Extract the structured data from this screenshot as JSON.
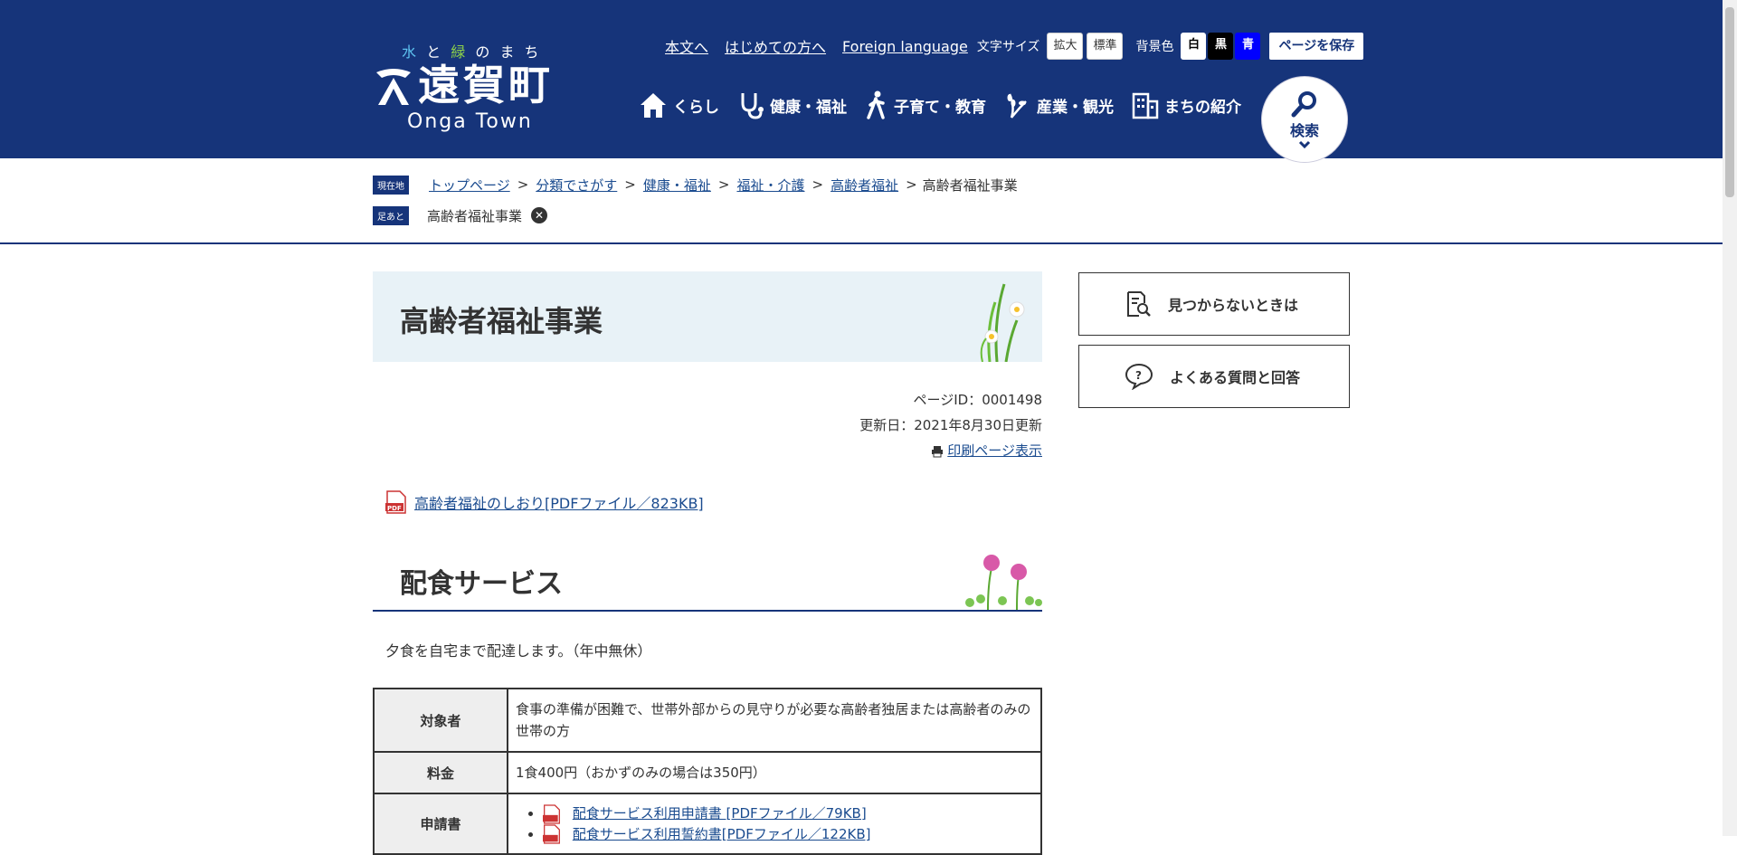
{
  "logo": {
    "tagline": [
      "水",
      "と",
      "緑",
      "の",
      "ま",
      "ち"
    ],
    "name": "遠賀町",
    "en": "Onga Town"
  },
  "util": {
    "links": [
      "本文へ",
      "はじめての方へ",
      "Foreign language"
    ],
    "font_size_label": "文字サイズ",
    "font_large": "拡大",
    "font_normal": "標準",
    "bg_label": "背景色",
    "bg_white": "白",
    "bg_black": "黒",
    "bg_blue": "青",
    "save_page": "ページを保存"
  },
  "gnav": [
    "くらし",
    "健康・福祉",
    "子育て・教育",
    "産業・観光",
    "まちの紹介"
  ],
  "search": {
    "label": "検索"
  },
  "breadcrumb": {
    "current_tag": "現在地",
    "trail_tag": "足あと",
    "links": [
      "トップページ",
      "分類でさがす",
      "健康・福祉",
      "福祉・介護",
      "高齢者福祉"
    ],
    "current": "高齢者福祉事業",
    "trail_item": "高齢者福祉事業",
    "sep": ">"
  },
  "page": {
    "title": "高齢者福祉事業",
    "page_id": "ページID：0001498",
    "updated": "更新日：2021年8月30日更新",
    "print": "印刷ページ表示",
    "pdf_link": "高齢者福祉のしおり[PDFファイル／823KB]"
  },
  "section": {
    "heading": "配食サービス",
    "desc": "夕食を自宅まで配達します。（年中無休）",
    "table": [
      {
        "th": "対象者",
        "td": "食事の準備が困難で、世帯外部からの見守りが必要な高齢者独居または高齢者のみの世帯の方"
      },
      {
        "th": "料金",
        "td": "1食400円（おかずのみの場合は350円）"
      },
      {
        "th": "申請書",
        "items": [
          "配食サービス利用申請書 [PDFファイル／79KB]",
          "配食サービス利用誓約書[PDFファイル／122KB]"
        ]
      }
    ]
  },
  "side": {
    "not_found": "見つからないときは",
    "faq": "よくある質問と回答"
  },
  "colors": {
    "header": "#16347a",
    "accent_link": "#1a4b8f"
  }
}
